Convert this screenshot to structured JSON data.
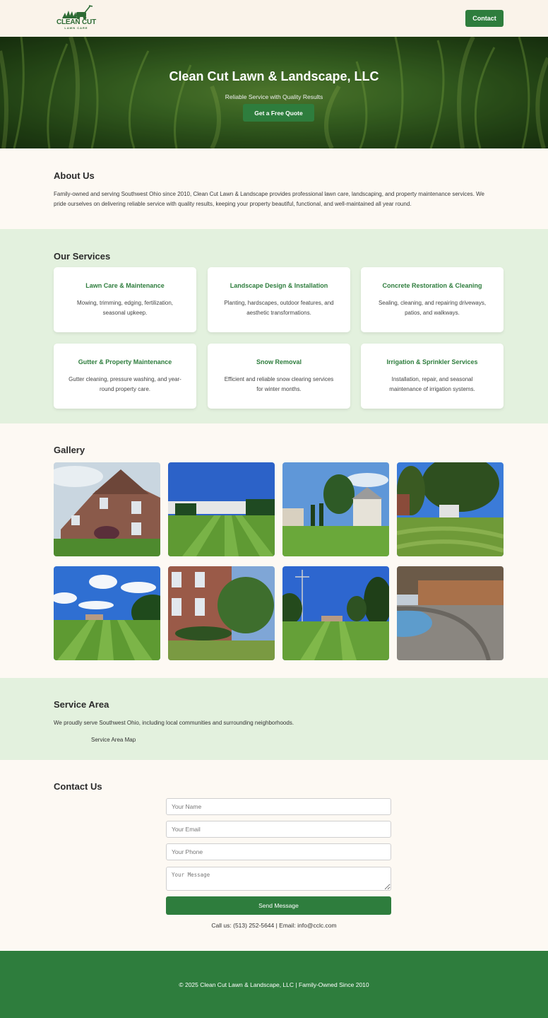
{
  "header": {
    "logo_name": "CLEAN CUT",
    "logo_sub": "LAWN CARE",
    "contact_label": "Contact"
  },
  "hero": {
    "title": "Clean Cut Lawn & Landscape, LLC",
    "subtitle": "Reliable Service with Quality Results",
    "cta_label": "Get a Free Quote"
  },
  "about": {
    "title": "About Us",
    "text": "Family-owned and serving Southwest Ohio since 2010, Clean Cut Lawn & Landscape provides professional lawn care, landscaping, and property maintenance services. We pride ourselves on delivering reliable service with quality results, keeping your property beautiful, functional, and well-maintained all year round."
  },
  "services": {
    "title": "Our Services",
    "items": [
      {
        "title": "Lawn Care & Maintenance",
        "desc": "Mowing, trimming, edging, fertilization, seasonal upkeep."
      },
      {
        "title": "Landscape Design & Installation",
        "desc": "Planting, hardscapes, outdoor features, and aesthetic transformations."
      },
      {
        "title": "Concrete Restoration & Cleaning",
        "desc": "Sealing, cleaning, and repairing driveways, patios, and walkways."
      },
      {
        "title": "Gutter & Property Maintenance",
        "desc": "Gutter cleaning, pressure washing, and year-round property care."
      },
      {
        "title": "Snow Removal",
        "desc": "Efficient and reliable snow clearing services for winter months."
      },
      {
        "title": "Irrigation & Sprinkler Services",
        "desc": "Installation, repair, and seasonal maintenance of irrigation systems."
      }
    ]
  },
  "gallery": {
    "title": "Gallery"
  },
  "area": {
    "title": "Service Area",
    "text": "We proudly serve Southwest Ohio, including local communities and surrounding neighborhoods.",
    "map_alt": "Service Area Map"
  },
  "contact": {
    "title": "Contact Us",
    "name_placeholder": "Your Name",
    "email_placeholder": "Your Email",
    "phone_placeholder": "Your Phone",
    "message_placeholder": "Your Message",
    "send_label": "Send Message",
    "call_text": "Call us: (513) 252-5644 | Email: info@cclc.com"
  },
  "footer": {
    "text": "© 2025 Clean Cut Lawn & Landscape, LLC | Family-Owned Since 2010"
  },
  "colors": {
    "accent": "#2e7d3d",
    "services_bg": "#e3f1de",
    "page_bg": "#fdf9f3"
  }
}
